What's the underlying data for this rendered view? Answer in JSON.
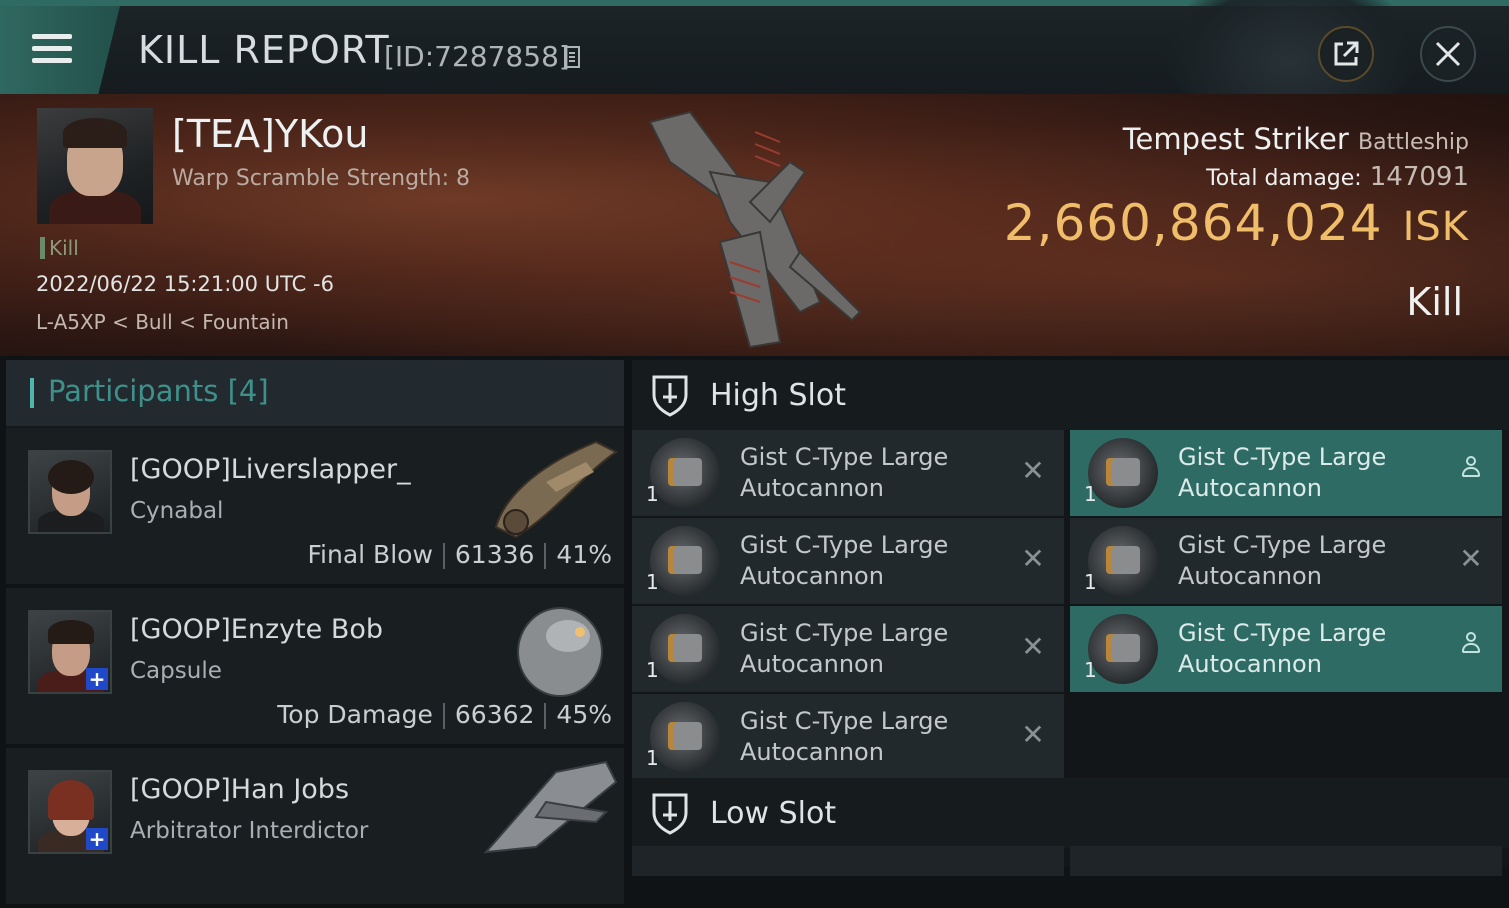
{
  "header": {
    "title": "KILL REPORT",
    "kill_id": "[ID:7287858]"
  },
  "victim": {
    "name": "[TEA]YKou",
    "warp_scramble": "Warp Scramble Strength: 8",
    "tag": "Kill",
    "datetime": "2022/06/22 15:21:00 UTC -6",
    "location": "L-A5XP < Bull < Fountain",
    "ship_name": "Tempest Striker",
    "ship_class": "Battleship",
    "total_damage_label": "Total damage:",
    "total_damage": "147091",
    "isk_value": "2,660,864,024",
    "isk_unit": "ISK",
    "result": "Kill"
  },
  "participants": {
    "label": "Participants [4]",
    "items": [
      {
        "name": "[GOOP]Liverslapper_",
        "ship": "Cynabal",
        "role": "Final Blow",
        "damage": "61336",
        "percent": "41%"
      },
      {
        "name": "[GOOP]Enzyte Bob",
        "ship": "Capsule",
        "role": "Top Damage",
        "damage": "66362",
        "percent": "45%"
      },
      {
        "name": "[GOOP]Han Jobs",
        "ship": "Arbitrator Interdictor",
        "role": "",
        "damage": "",
        "percent": ""
      }
    ]
  },
  "slots": {
    "high_label": "High Slot",
    "low_label": "Low Slot",
    "high_modules": [
      {
        "line1": "Gist C-Type Large",
        "line2": "Autocannon",
        "qty": "1",
        "state": "destroyed"
      },
      {
        "line1": "Gist C-Type Large",
        "line2": "Autocannon",
        "qty": "1",
        "state": "dropped"
      },
      {
        "line1": "Gist C-Type Large",
        "line2": "Autocannon",
        "qty": "1",
        "state": "destroyed"
      },
      {
        "line1": "Gist C-Type Large",
        "line2": "Autocannon",
        "qty": "1",
        "state": "destroyed"
      },
      {
        "line1": "Gist C-Type Large",
        "line2": "Autocannon",
        "qty": "1",
        "state": "destroyed"
      },
      {
        "line1": "Gist C-Type Large",
        "line2": "Autocannon",
        "qty": "1",
        "state": "dropped"
      },
      {
        "line1": "Gist C-Type Large",
        "line2": "Autocannon",
        "qty": "1",
        "state": "destroyed"
      }
    ]
  },
  "colors": {
    "accent": "#2f6860",
    "isk": "#f0bd6a",
    "dropped_highlight": "#2e6b65"
  }
}
